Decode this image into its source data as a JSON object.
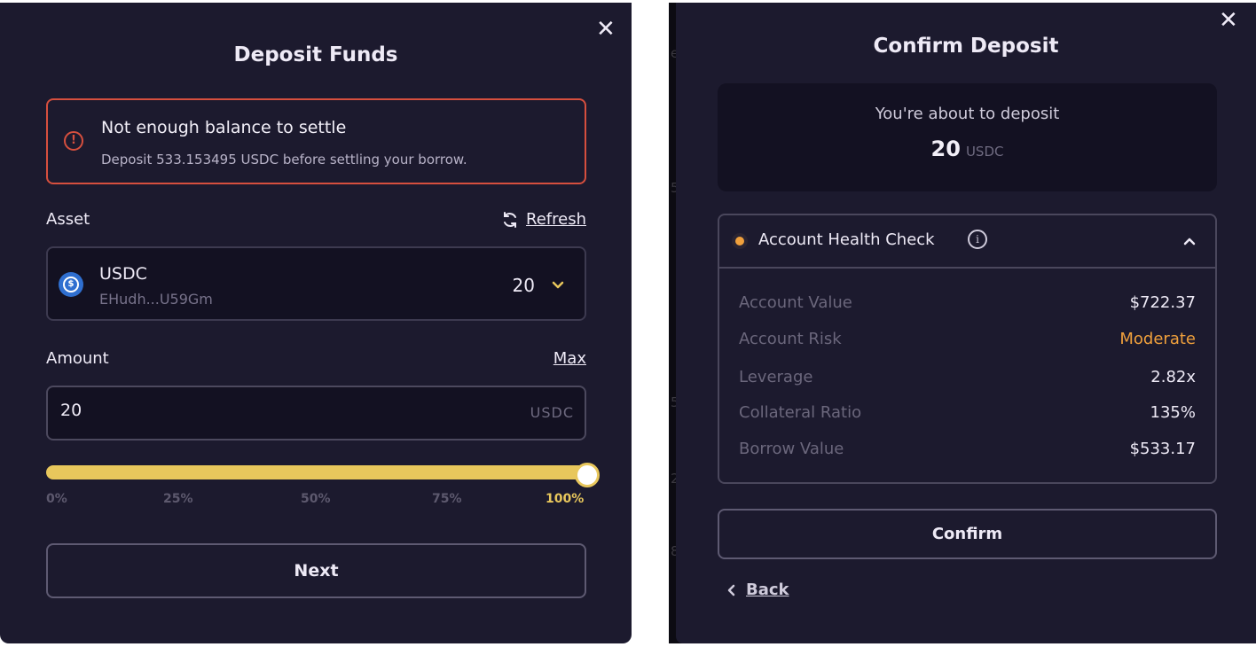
{
  "deposit_panel": {
    "title": "Deposit Funds",
    "close_icon": "close-icon",
    "alert": {
      "icon": "alert-circle-icon",
      "title": "Not enough balance to settle",
      "message": "Deposit 533.153495 USDC before settling your borrow.",
      "color": "#d64f3e"
    },
    "asset_label": "Asset",
    "refresh_icon": "refresh-icon",
    "refresh_label": "Refresh",
    "asset_select": {
      "icon": "usdc-coin-icon",
      "name": "USDC",
      "address": "EHudh...U59Gm",
      "balance": "20"
    },
    "amount_label": "Amount",
    "max_label": "Max",
    "amount_input": {
      "value": "20",
      "unit": "USDC"
    },
    "slider": {
      "value_percent": 100,
      "ticks": [
        "0%",
        "25%",
        "50%",
        "75%",
        "100%"
      ],
      "accent_color": "#e8c75c"
    },
    "next_label": "Next"
  },
  "background_ghost_text": [
    "e",
    "5",
    "5",
    "2",
    "8"
  ],
  "confirm_panel": {
    "title": "Confirm Deposit",
    "close_icon": "close-icon",
    "summary": {
      "subtitle": "You're about to deposit",
      "amount": "20",
      "unit": "USDC"
    },
    "health_check": {
      "title": "Account Health Check",
      "status_color": "#f0a03c",
      "expanded": true,
      "rows": [
        {
          "label": "Account Value",
          "value": "$722.37"
        },
        {
          "label": "Account Risk",
          "value": "Moderate"
        },
        {
          "label": "Leverage",
          "value": "2.82x"
        },
        {
          "label": "Collateral Ratio",
          "value": "135%"
        },
        {
          "label": "Borrow Value",
          "value": "$533.17"
        }
      ]
    },
    "confirm_label": "Confirm",
    "back_label": "Back"
  }
}
